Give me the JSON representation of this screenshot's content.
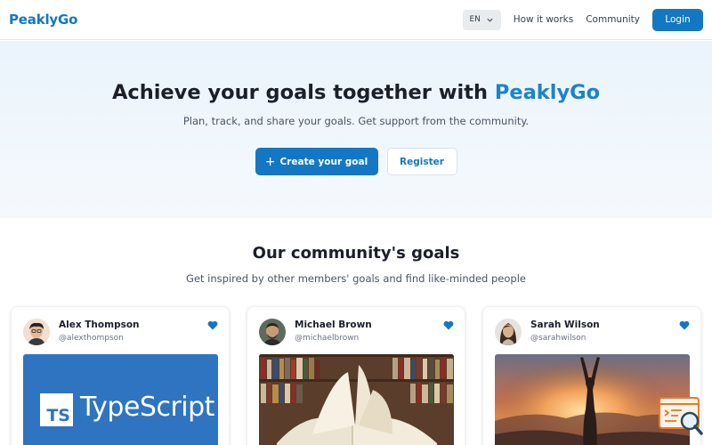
{
  "header": {
    "logo": "PeaklyGo",
    "lang": "EN",
    "nav": [
      "How it works",
      "Community"
    ],
    "login": "Login"
  },
  "hero": {
    "title_prefix": "Achieve your goals together with",
    "title_brand": "PeaklyGo",
    "subtitle": "Plan, track, and share your goals. Get support from the community.",
    "primary_button": "Create your goal",
    "secondary_button": "Register"
  },
  "community": {
    "title": "Our community's goals",
    "subtitle": "Get inspired by other members' goals and find like-minded people",
    "cards": [
      {
        "name": "Alex Thompson",
        "handle": "@alexthompson",
        "image": "typescript-logo",
        "image_text": "TypeScript",
        "badge_text": "TS"
      },
      {
        "name": "Michael Brown",
        "handle": "@michaelbrown",
        "image": "open-book-library"
      },
      {
        "name": "Sarah Wilson",
        "handle": "@sarahwilson",
        "image": "yoga-sunset"
      }
    ]
  },
  "colors": {
    "brand": "#1477c4",
    "brand_light": "#1c84c9",
    "heart": "#1477c4"
  }
}
